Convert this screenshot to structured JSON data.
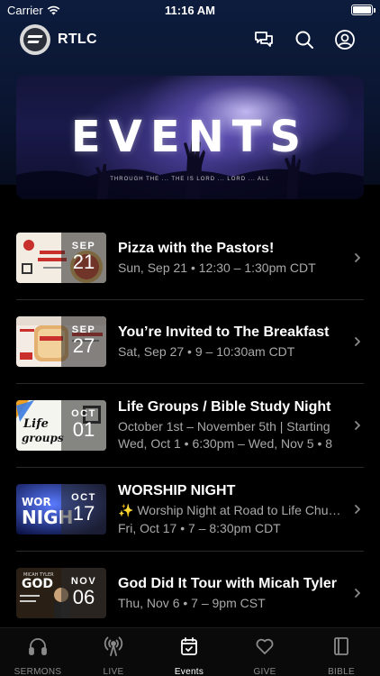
{
  "status_bar": {
    "carrier": "Carrier",
    "time": "11:16 AM"
  },
  "header": {
    "title": "RTLC",
    "icons": [
      "chat-icon",
      "search-icon",
      "profile-icon"
    ]
  },
  "banner": {
    "title": "EVENTS",
    "caption": "THROUGH THE ... THE IS LORD ... LORD ... ALL"
  },
  "events": [
    {
      "title": "Pizza with the Pastors!",
      "lines": [
        "Sun, Sep 21 • 12:30 – 1:30pm CDT"
      ],
      "month": "SEP",
      "day": "21"
    },
    {
      "title": "You’re Invited to The Breakfast",
      "lines": [
        "Sat, Sep 27 • 9 – 10:30am CDT"
      ],
      "month": "SEP",
      "day": "27"
    },
    {
      "title": "Life Groups / Bible Study Night",
      "lines": [
        "October 1st – November 5th | Starting",
        "Wed, Oct 1 • 6:30pm – Wed, Nov 5 • 8"
      ],
      "month": "OCT",
      "day": "01"
    },
    {
      "title": "WORSHIP NIGHT",
      "lines": [
        "✨ Worship Night at Road to Life Church",
        "Fri, Oct 17 • 7 – 8:30pm CDT"
      ],
      "month": "OCT",
      "day": "17"
    },
    {
      "title": "God Did It Tour with Micah Tyler",
      "lines": [
        "Thu, Nov 6 • 7 – 9pm CST"
      ],
      "month": "NOV",
      "day": "06"
    }
  ],
  "tabs": [
    {
      "label": "SERMONS",
      "icon": "headphones-icon",
      "active": false
    },
    {
      "label": "LIVE",
      "icon": "broadcast-icon",
      "active": false
    },
    {
      "label": "Events",
      "icon": "calendar-icon",
      "active": true
    },
    {
      "label": "GIVE",
      "icon": "heart-icon",
      "active": false
    },
    {
      "label": "BIBLE",
      "icon": "book-icon",
      "active": false
    }
  ]
}
